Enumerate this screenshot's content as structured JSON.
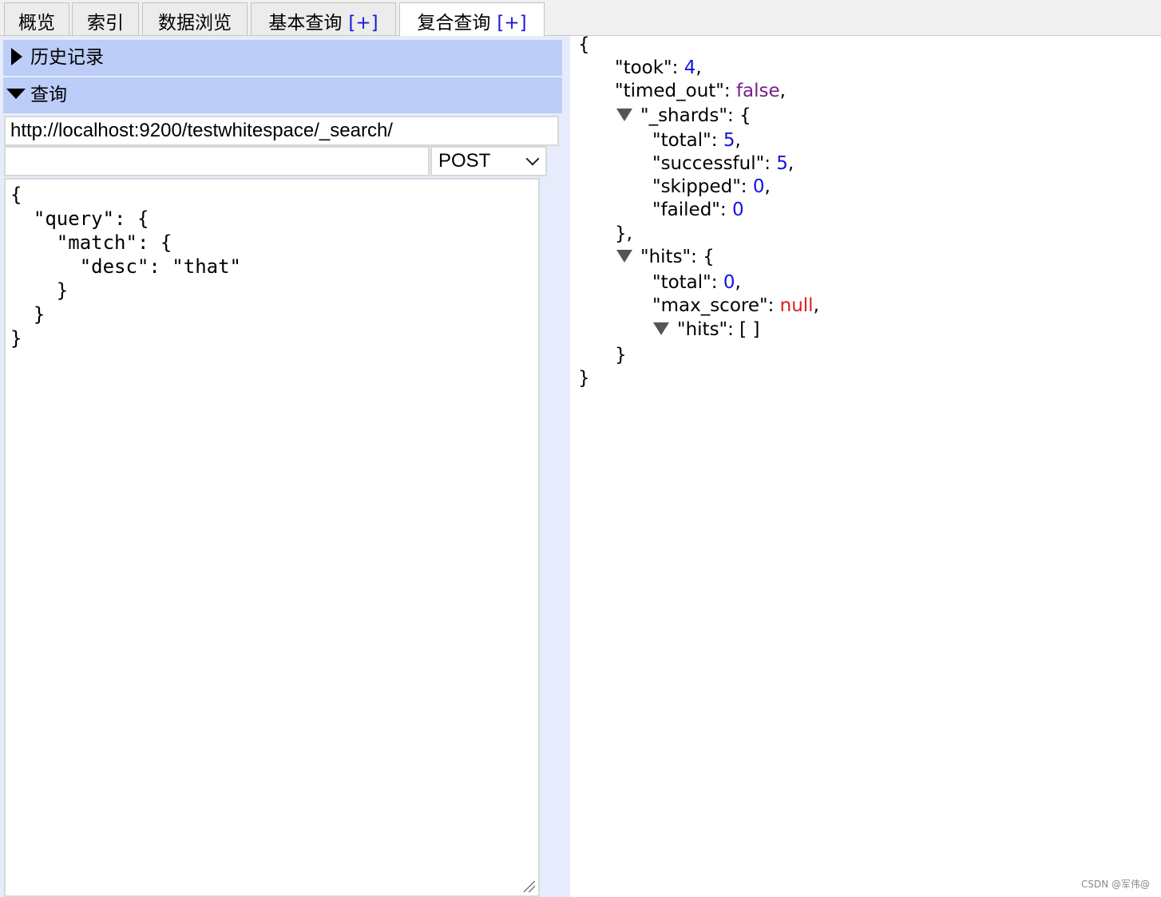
{
  "tabs": [
    {
      "label": "概览",
      "plus": ""
    },
    {
      "label": "索引",
      "plus": ""
    },
    {
      "label": "数据浏览",
      "plus": ""
    },
    {
      "label": "基本查询",
      "plus": "[+]"
    },
    {
      "label": "复合查询",
      "plus": "[+]"
    }
  ],
  "active_tab": "复合查询",
  "sections": {
    "history": "历史记录",
    "query": "查询"
  },
  "request": {
    "url": "http://localhost:9200/testwhitespace/_search/",
    "path": "",
    "method": "POST",
    "body_lines": [
      "{",
      "  \"query\": {",
      "    \"match\": {",
      "      \"desc\": \"that\"",
      "    }",
      "  }",
      "}"
    ]
  },
  "response": {
    "open_brace": "{",
    "close_brace": "}",
    "took_key": "\"took\": ",
    "took_val": "4",
    "timed_out_key": "\"timed_out\": ",
    "timed_out_val": "false",
    "shards_key": "\"_shards\": {",
    "shards_total_key": "\"total\": ",
    "shards_total_val": "5",
    "shards_successful_key": "\"successful\": ",
    "shards_successful_val": "5",
    "shards_skipped_key": "\"skipped\": ",
    "shards_skipped_val": "0",
    "shards_failed_key": "\"failed\": ",
    "shards_failed_val": "0",
    "shards_close": "},",
    "hits_key": "\"hits\": {",
    "hits_total_key": "\"total\": ",
    "hits_total_val": "0",
    "max_score_key": "\"max_score\": ",
    "max_score_val": "null",
    "hits_array": "\"hits\": [ ]",
    "hits_close": "}"
  },
  "footer_credit": "CSDN @军伟@",
  "colors": {
    "section_header": "#bccdf8",
    "left_bg": "#e6ecfb",
    "number": "#1414e0",
    "boolean": "#7a1d8a",
    "null": "#e21c1c",
    "tab_plus": "#1a1ad6"
  }
}
